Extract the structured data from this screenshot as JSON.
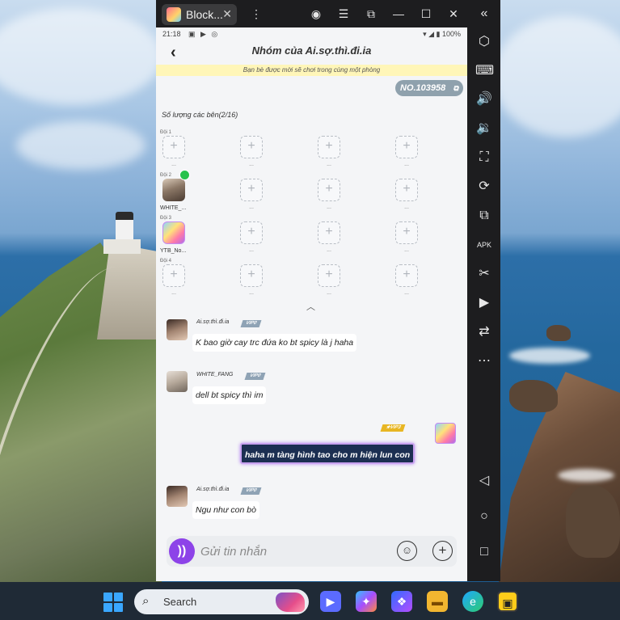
{
  "emulator": {
    "tab_title": "Block...",
    "tab_close": "✕",
    "titlebar_icons": [
      "account-icon",
      "menu-icon",
      "popout-icon",
      "minimize-icon",
      "maximize-icon",
      "close-icon"
    ],
    "sidebar_icons": [
      "collapse-icon",
      "settings-hex-icon",
      "keyboard-mapping-icon",
      "volume-up-icon",
      "volume-down-icon",
      "screenshot-icon",
      "rotate-icon",
      "multi-instance-icon",
      "apk-icon",
      "scissors-icon",
      "record-icon",
      "sync-icon",
      "more-icon",
      "android-back-icon",
      "android-home-icon",
      "android-recents-icon"
    ]
  },
  "status_bar": {
    "time": "21:18",
    "battery": "100%"
  },
  "header": {
    "back": "‹",
    "title": "Nhóm của Ai.sợ.thì.đi.ia"
  },
  "banner": "Bạn bè được mời sẽ chơi trong cùng một phòng",
  "room": {
    "code": "NO.103958"
  },
  "parties_label": "Số lượng các bên(2/16)",
  "teams": [
    {
      "label": "Đội 1",
      "members": []
    },
    {
      "label": "Đội 2",
      "members": [
        {
          "name": "WHITE_..."
        }
      ]
    },
    {
      "label": "Đội 3",
      "members": [
        {
          "name": "YTB_No..."
        }
      ]
    },
    {
      "label": "Đội 4",
      "members": []
    }
  ],
  "slot_plus": "+",
  "slot_dots": "...",
  "messages": [
    {
      "name": "Ai.sợ.thì.đi.ia",
      "vip": "VIP0",
      "text": "K bao giờ cay trc đứa ko bt spicy là j haha",
      "self": false
    },
    {
      "name": "WHITE_FANG",
      "vip": "VIP0",
      "text": "dell bt spicy thì im",
      "self": false
    },
    {
      "name": "",
      "vip": "★VIP3",
      "text": "haha m tàng hình tao cho m hiện lun con",
      "self": true
    },
    {
      "name": "Ai.sợ.thì.đi.ia",
      "vip": "VIP0",
      "text": "Ngu như con bò",
      "self": false
    }
  ],
  "input": {
    "placeholder": "Gửi tin nhắn",
    "value": ""
  },
  "taskbar": {
    "search_text": "Search",
    "apps": [
      "windows-start-icon",
      "meet-icon",
      "copilot-icon",
      "copilot-pro-icon",
      "file-explorer-icon",
      "edge-icon",
      "blockman-emulator-icon"
    ]
  },
  "colors": {
    "accent_purple": "#8d43e8",
    "banner_yellow": "#fff6b8",
    "self_bubble": "#1c2f52",
    "vip0": "#8fa3b5",
    "vip3": "#e8b623"
  }
}
